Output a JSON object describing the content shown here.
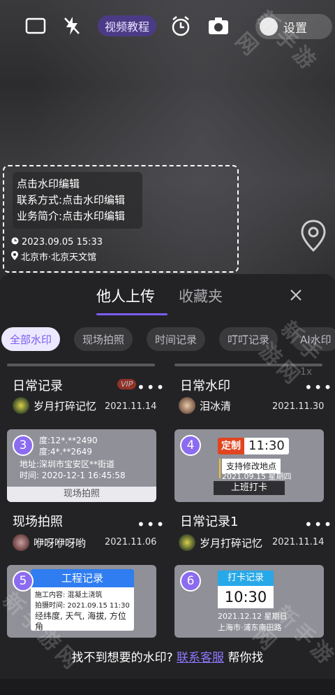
{
  "top_bar": {
    "video_tutorial": "视频教程",
    "settings": "设置"
  },
  "watermark_preview": {
    "line1": "点击水印编辑",
    "line2": "联系方式:点击水印编辑",
    "line3": "业务简介:点击水印编辑",
    "datetime": "2023.09.05 15:33",
    "location": "北京市·北京天文馆"
  },
  "sheet": {
    "tabs": [
      "他人上传",
      "收藏夹"
    ],
    "chips": [
      "全部水印",
      "现场拍照",
      "时间记录",
      "叮叮记录",
      "AI水印"
    ],
    "zoom_hint": "1x",
    "templates": [
      {
        "title": "日常记录",
        "vip": "VIP",
        "user": "岁月打碎记忆",
        "date": "2021.11.14",
        "badge": "3"
      },
      {
        "title": "日常水印",
        "user": "泪冰清",
        "date": "2021.11.30",
        "badge": "4"
      },
      {
        "title": "现场拍照",
        "user": "咿呀咿呀哟",
        "date": "2021.11.06",
        "badge": "5"
      },
      {
        "title": "日常记录1",
        "user": "岁月打碎记忆",
        "date": "2021.11.14",
        "badge": "6"
      }
    ],
    "thumb3": {
      "l1": "度:12*.**2490",
      "l2": "度:4*.**2649",
      "l3": "地址:深圳市宝安区**街道",
      "l4": "时间: 2020-12-1 16:45:58",
      "footer": "现场拍照"
    },
    "thumb4": {
      "tag": "定制",
      "time": "11:30",
      "desc": "支持修改地点",
      "date": "2021.09.15 星期四",
      "footer": "上班打卡"
    },
    "thumb5": {
      "title": "工程记录",
      "l1": "施工内容: 混凝土浇筑",
      "l2": "拍摄时间: 2021.09.15 11:30",
      "l3": "经纬度, 天气, 海拔, 方位角"
    },
    "thumb6": {
      "title": "打卡记录",
      "time": "10:30",
      "date": "2021.12.12 星期日",
      "loc": "上海市·浦东南田路"
    }
  },
  "bottom": {
    "prompt_before": "找不到想要的水印?",
    "prompt_link": "联系客服",
    "prompt_after": "帮你找"
  },
  "site_watermark": "新手游网",
  "colors": {
    "accent": "#7b5bf2",
    "sheet_bg": "#232325",
    "vip": "#c0392b"
  }
}
